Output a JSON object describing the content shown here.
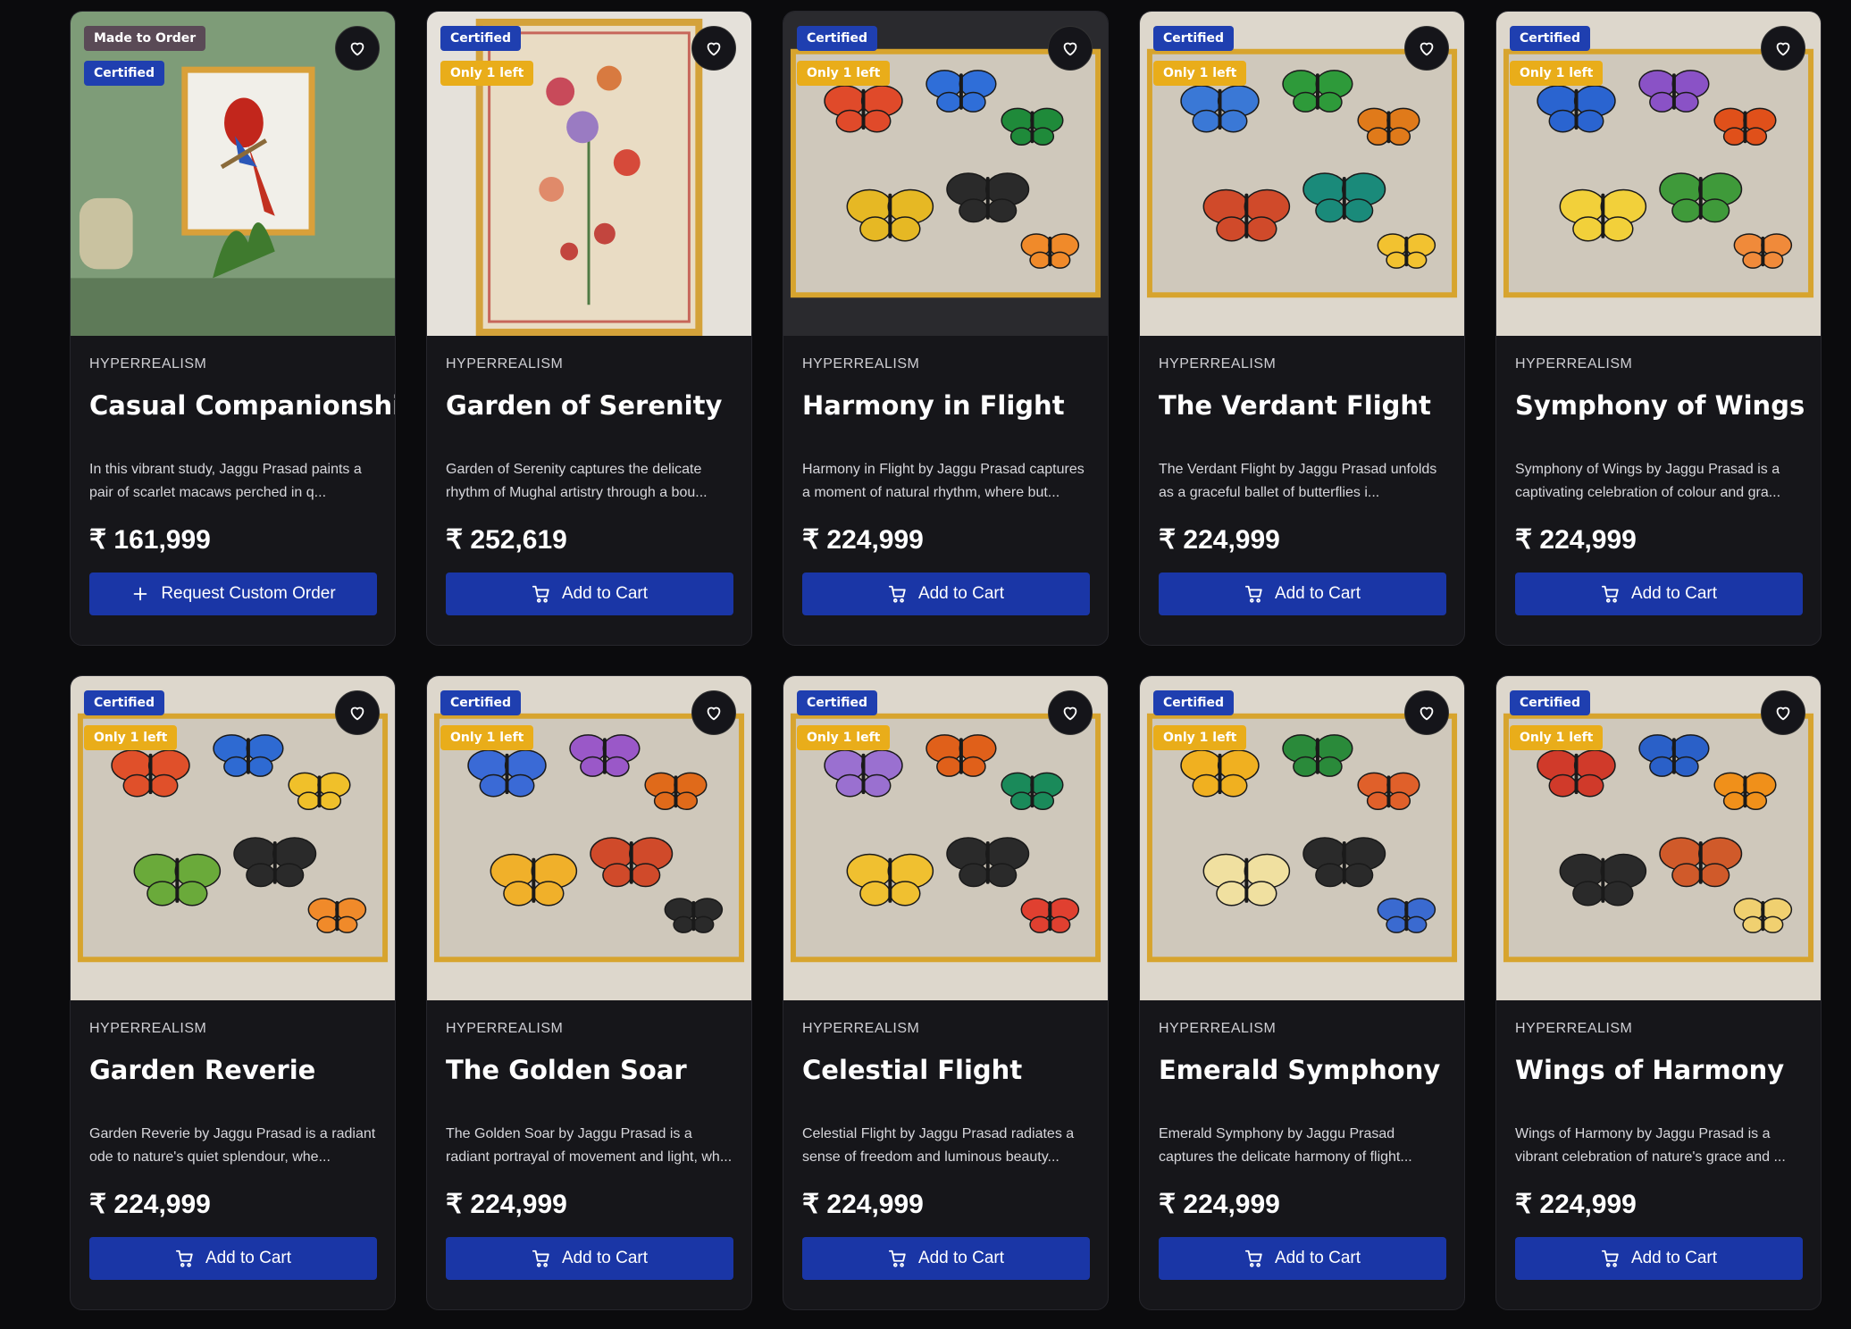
{
  "products": [
    {
      "category": "HYPERREALISM",
      "title": "Casual Companionship",
      "description": "In this vibrant study, Jaggu Prasad paints a pair of scarlet macaws perched in q...",
      "price": "₹ 161,999",
      "button": {
        "label": "Request Custom Order",
        "icon": "plus-icon"
      },
      "badges": {
        "made_to_order": "Made to Order",
        "certified": "Certified"
      },
      "art": "macaw"
    },
    {
      "category": "HYPERREALISM",
      "title": "Garden of Serenity",
      "description": "Garden of Serenity captures the delicate rhythm of Mughal artistry through a bou...",
      "price": "₹ 252,619",
      "button": {
        "label": "Add to Cart",
        "icon": "cart-icon"
      },
      "badges": {
        "certified": "Certified",
        "stock": "Only 1 left"
      },
      "art": "floral"
    },
    {
      "category": "HYPERREALISM",
      "title": "Harmony in Flight",
      "description": "Harmony in Flight by Jaggu Prasad captures a moment of natural rhythm, where but...",
      "price": "₹ 224,999",
      "button": {
        "label": "Add to Cart",
        "icon": "cart-icon"
      },
      "badges": {
        "certified": "Certified",
        "stock": "Only 1 left"
      },
      "art": "butterfly"
    },
    {
      "category": "HYPERREALISM",
      "title": "The Verdant Flight",
      "description": "The Verdant Flight by Jaggu Prasad unfolds as a graceful ballet of butterflies i...",
      "price": "₹ 224,999",
      "button": {
        "label": "Add to Cart",
        "icon": "cart-icon"
      },
      "badges": {
        "certified": "Certified",
        "stock": "Only 1 left"
      },
      "art": "butterfly"
    },
    {
      "category": "HYPERREALISM",
      "title": "Symphony of Wings",
      "description": "Symphony of Wings by Jaggu Prasad is a captivating celebration of colour and gra...",
      "price": "₹ 224,999",
      "button": {
        "label": "Add to Cart",
        "icon": "cart-icon"
      },
      "badges": {
        "certified": "Certified",
        "stock": "Only 1 left"
      },
      "art": "butterfly"
    },
    {
      "category": "HYPERREALISM",
      "title": "Garden Reverie",
      "description": "Garden Reverie by Jaggu Prasad is a radiant ode to nature's quiet splendour, whe...",
      "price": "₹ 224,999",
      "button": {
        "label": "Add to Cart",
        "icon": "cart-icon"
      },
      "badges": {
        "certified": "Certified",
        "stock": "Only 1 left"
      },
      "art": "butterfly"
    },
    {
      "category": "HYPERREALISM",
      "title": "The Golden Soar",
      "description": "The Golden Soar by Jaggu Prasad is a radiant portrayal of movement and light, wh...",
      "price": "₹ 224,999",
      "button": {
        "label": "Add to Cart",
        "icon": "cart-icon"
      },
      "badges": {
        "certified": "Certified",
        "stock": "Only 1 left"
      },
      "art": "butterfly"
    },
    {
      "category": "HYPERREALISM",
      "title": "Celestial Flight",
      "description": "Celestial Flight by Jaggu Prasad radiates a sense of freedom and luminous beauty...",
      "price": "₹ 224,999",
      "button": {
        "label": "Add to Cart",
        "icon": "cart-icon"
      },
      "badges": {
        "certified": "Certified",
        "stock": "Only 1 left"
      },
      "art": "butterfly"
    },
    {
      "category": "HYPERREALISM",
      "title": "Emerald Symphony",
      "description": "Emerald Symphony by Jaggu Prasad captures the delicate harmony of flight...",
      "price": "₹ 224,999",
      "button": {
        "label": "Add to Cart",
        "icon": "cart-icon"
      },
      "badges": {
        "certified": "Certified",
        "stock": "Only 1 left"
      },
      "art": "butterfly"
    },
    {
      "category": "HYPERREALISM",
      "title": "Wings of Harmony",
      "description": "Wings of Harmony by Jaggu Prasad is a vibrant celebration of nature's grace and ...",
      "price": "₹ 224,999",
      "button": {
        "label": "Add to Cart",
        "icon": "cart-icon"
      },
      "badges": {
        "certified": "Certified",
        "stock": "Only 1 left"
      },
      "art": "butterfly"
    }
  ],
  "colors": {
    "button": "#1a36a6",
    "certified_badge": "#1f3fb0",
    "stock_badge": "#e9ad1a",
    "made_badge": "#5a4a56",
    "page_bg": "#0b0b0d",
    "card_bg": "#16161a"
  },
  "icons": {
    "favorite": "heart-icon",
    "cart": "cart-icon",
    "plus": "plus-icon"
  }
}
